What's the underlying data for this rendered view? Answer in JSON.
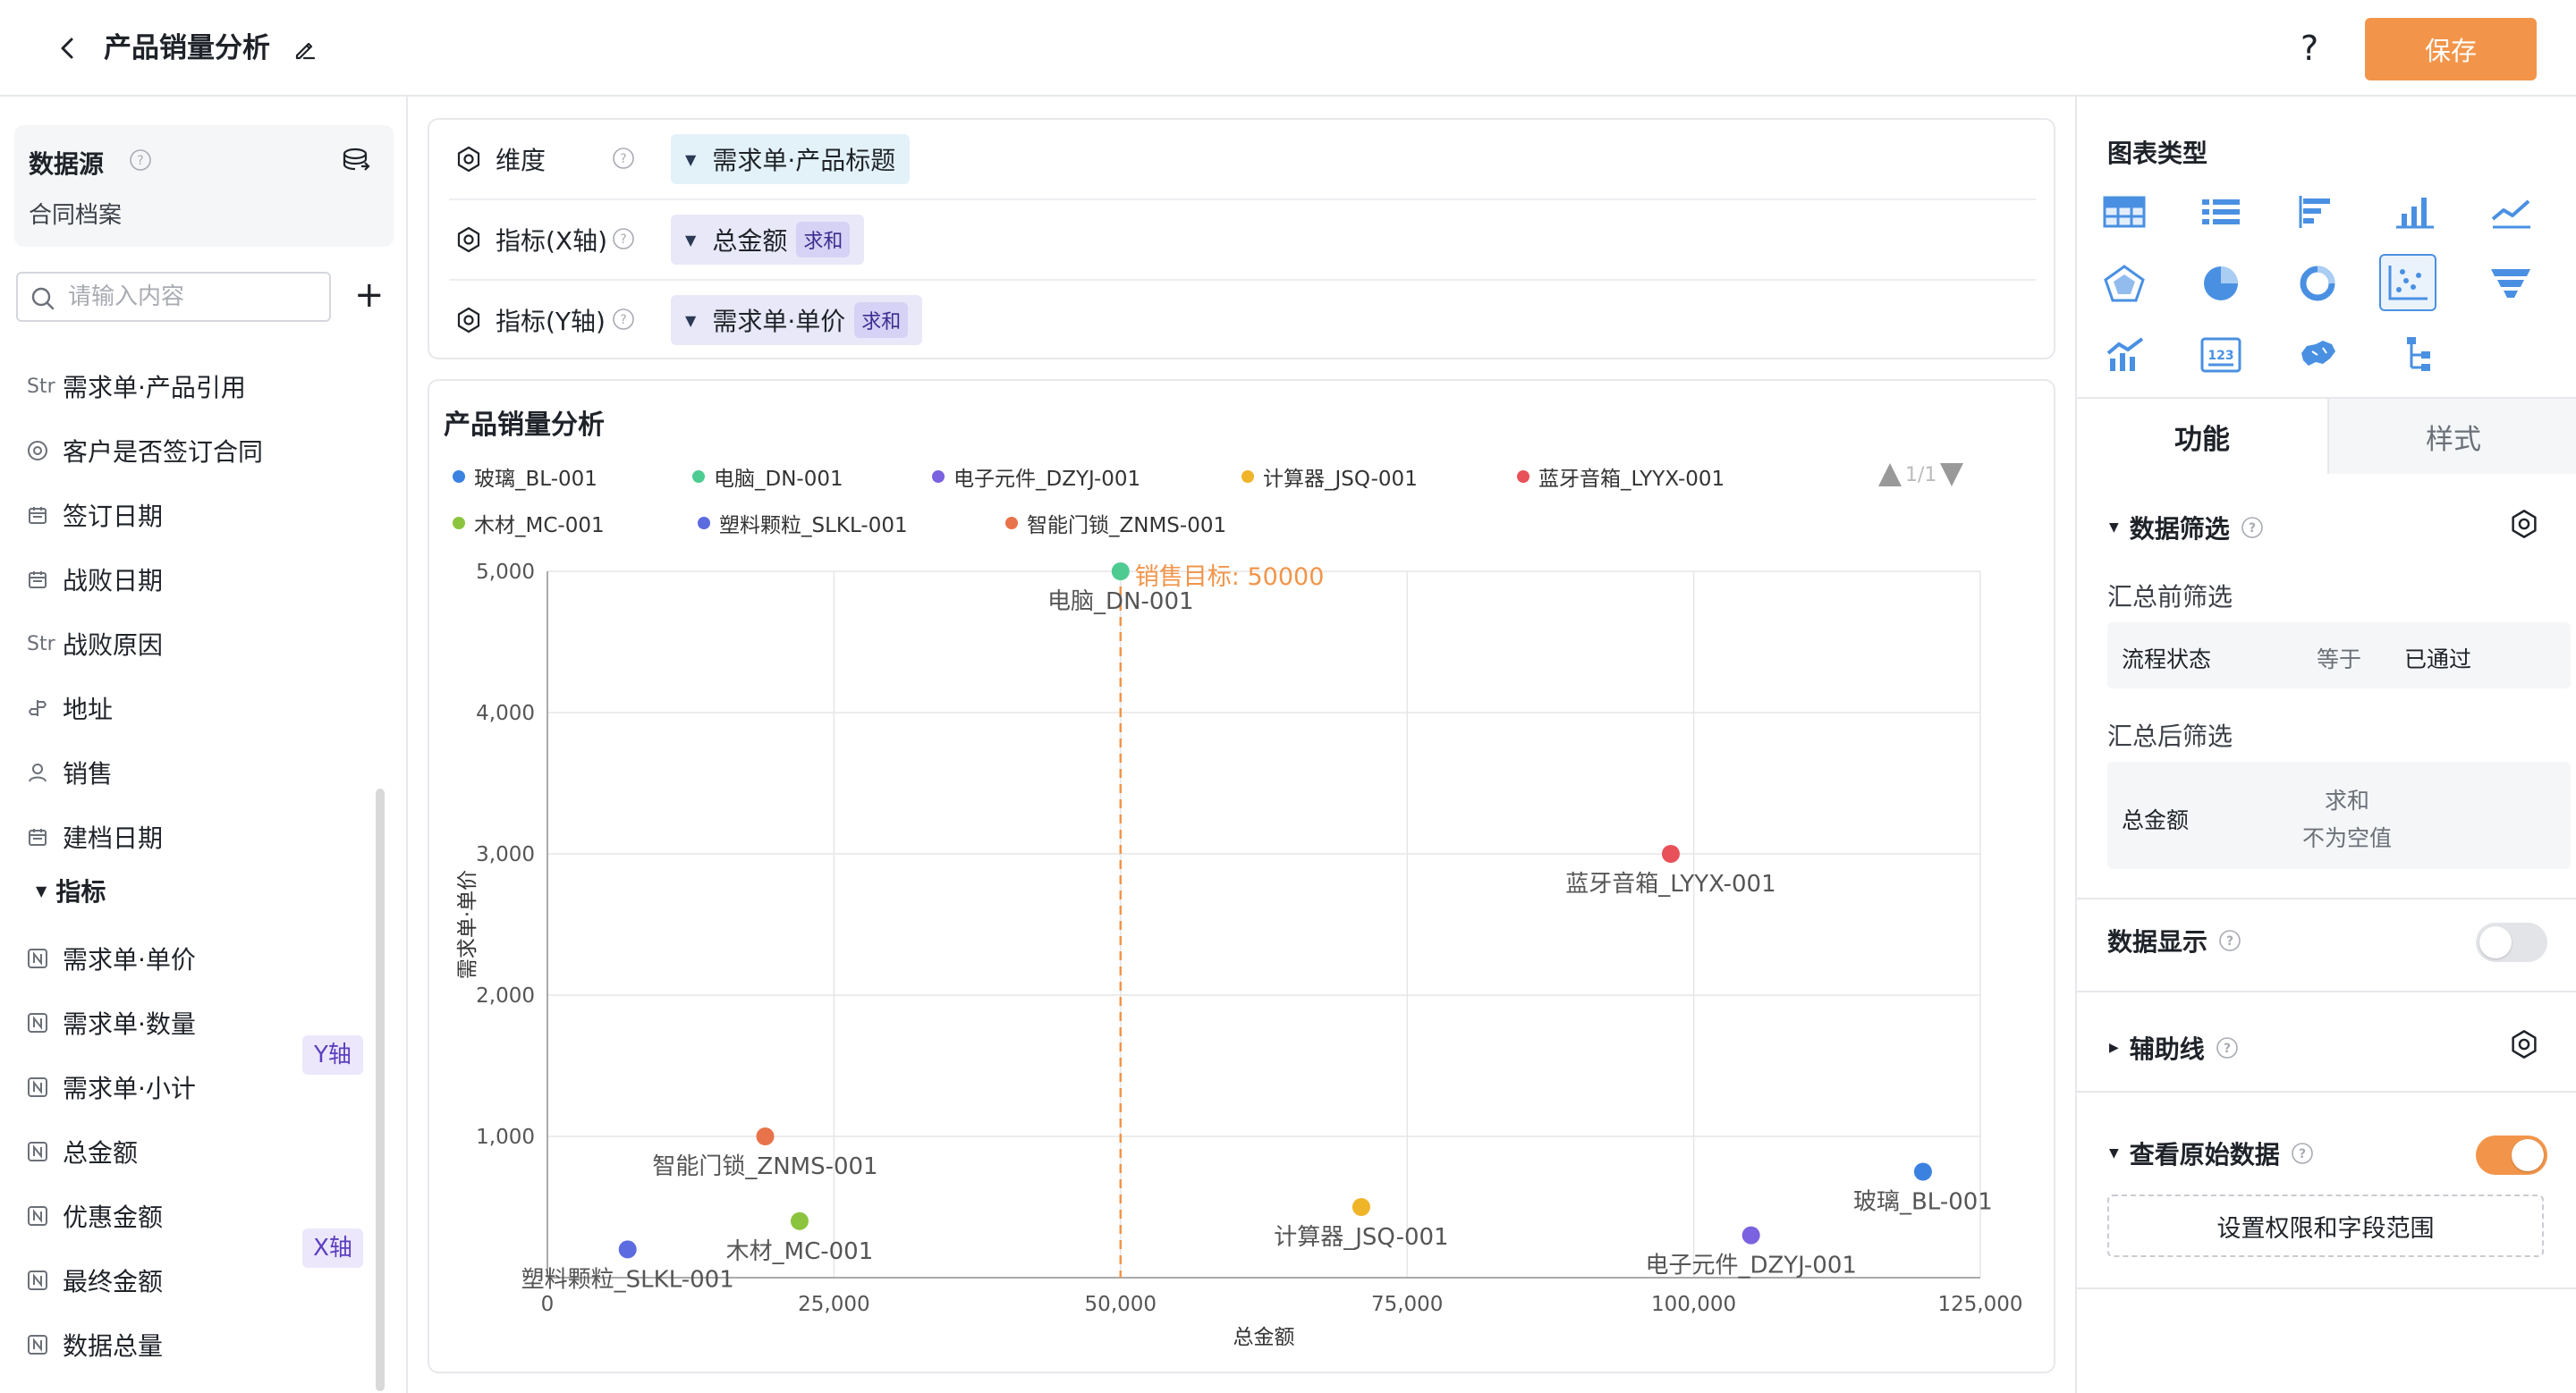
{
  "header": {
    "title": "产品销量分析",
    "help": "?",
    "save_label": "保存"
  },
  "sidebar": {
    "datasource_title": "数据源",
    "datasource_name": "合同档案",
    "search_placeholder": "请输入内容",
    "add": "+",
    "dimension_fields": [
      {
        "type": "Str",
        "label": "需求单·产品引用"
      },
      {
        "type": "radio",
        "label": "客户是否签订合同"
      },
      {
        "type": "date",
        "label": "签订日期"
      },
      {
        "type": "date",
        "label": "战败日期"
      },
      {
        "type": "Str",
        "label": "战败原因"
      },
      {
        "type": "location",
        "label": "地址"
      },
      {
        "type": "user",
        "label": "销售"
      },
      {
        "type": "date",
        "label": "建档日期"
      }
    ],
    "metrics_header": "指标",
    "metric_fields": [
      {
        "label": "需求单·单价",
        "badge": "Y轴"
      },
      {
        "label": "需求单·数量",
        "badge": ""
      },
      {
        "label": "需求单·小计",
        "badge": ""
      },
      {
        "label": "总金额",
        "badge": "X轴"
      },
      {
        "label": "优惠金额",
        "badge": ""
      },
      {
        "label": "最终金额",
        "badge": ""
      },
      {
        "label": "数据总量",
        "badge": ""
      }
    ]
  },
  "config": {
    "dimension_label": "维度",
    "dimension_value": "需求单·产品标题",
    "x_label": "指标(X轴)",
    "x_value": "总金额",
    "x_agg": "求和",
    "y_label": "指标(Y轴)",
    "y_value": "需求单·单价",
    "y_agg": "求和"
  },
  "chart": {
    "title": "产品销量分析",
    "pager": "1/1"
  },
  "chart_data": {
    "type": "scatter",
    "title": "产品销量分析",
    "xlabel": "总金额",
    "ylabel": "需求单·单价",
    "xlim": [
      0,
      125000
    ],
    "ylim": [
      0,
      5000
    ],
    "xticks": [
      0,
      25000,
      50000,
      75000,
      100000,
      125000
    ],
    "yticks": [
      1000,
      2000,
      3000,
      4000,
      5000
    ],
    "xtick_labels": [
      "0",
      "25,000",
      "50,000",
      "75,000",
      "100,000",
      "125,000"
    ],
    "ytick_labels": [
      "1,000",
      "2,000",
      "3,000",
      "4,000",
      "5,000"
    ],
    "grid": true,
    "legend_position": "top",
    "reference_line": {
      "axis": "x",
      "value": 50000,
      "label": "销售目标: 50000",
      "color": "#f2954a"
    },
    "series": [
      {
        "name": "玻璃_BL-001",
        "color": "#3b82e0",
        "x": 120000,
        "y": 750
      },
      {
        "name": "电脑_DN-001",
        "color": "#4ecb91",
        "x": 50000,
        "y": 5000
      },
      {
        "name": "电子元件_DZYJ-001",
        "color": "#7b62e0",
        "x": 105000,
        "y": 300
      },
      {
        "name": "计算器_JSQ-001",
        "color": "#f0b429",
        "x": 71000,
        "y": 500
      },
      {
        "name": "蓝牙音箱_LYYX-001",
        "color": "#e8515a",
        "x": 98000,
        "y": 3000
      },
      {
        "name": "木材_MC-001",
        "color": "#8bc53f",
        "x": 22000,
        "y": 400
      },
      {
        "name": "塑料颗粒_SLKL-001",
        "color": "#5c6bdf",
        "x": 7000,
        "y": 200
      },
      {
        "name": "智能门锁_ZNMS-001",
        "color": "#e8734a",
        "x": 19000,
        "y": 1000
      }
    ]
  },
  "right_panel": {
    "chart_type_title": "图表类型",
    "chart_types": [
      "table-icon",
      "list-icon",
      "bar-horizontal-icon",
      "bar-icon",
      "line-icon",
      "radar-icon",
      "pie-icon",
      "donut-icon",
      "scatter-icon",
      "funnel-icon",
      "combo-icon",
      "number-card-icon",
      "map-icon",
      "tree-icon"
    ],
    "active_type": "scatter-icon",
    "tab_function": "功能",
    "tab_style": "样式",
    "data_filter_title": "数据筛选",
    "pre_filter_label": "汇总前筛选",
    "pre_filter": {
      "field": "流程状态",
      "op": "等于",
      "value": "已通过"
    },
    "post_filter_label": "汇总后筛选",
    "post_filter": {
      "field": "总金额",
      "agg": "求和",
      "cond": "不为空值"
    },
    "data_display_label": "数据显示",
    "data_display_on": false,
    "aux_line_label": "辅助线",
    "raw_data_label": "查看原始数据",
    "raw_data_on": true,
    "permission_button": "设置权限和字段范围"
  }
}
